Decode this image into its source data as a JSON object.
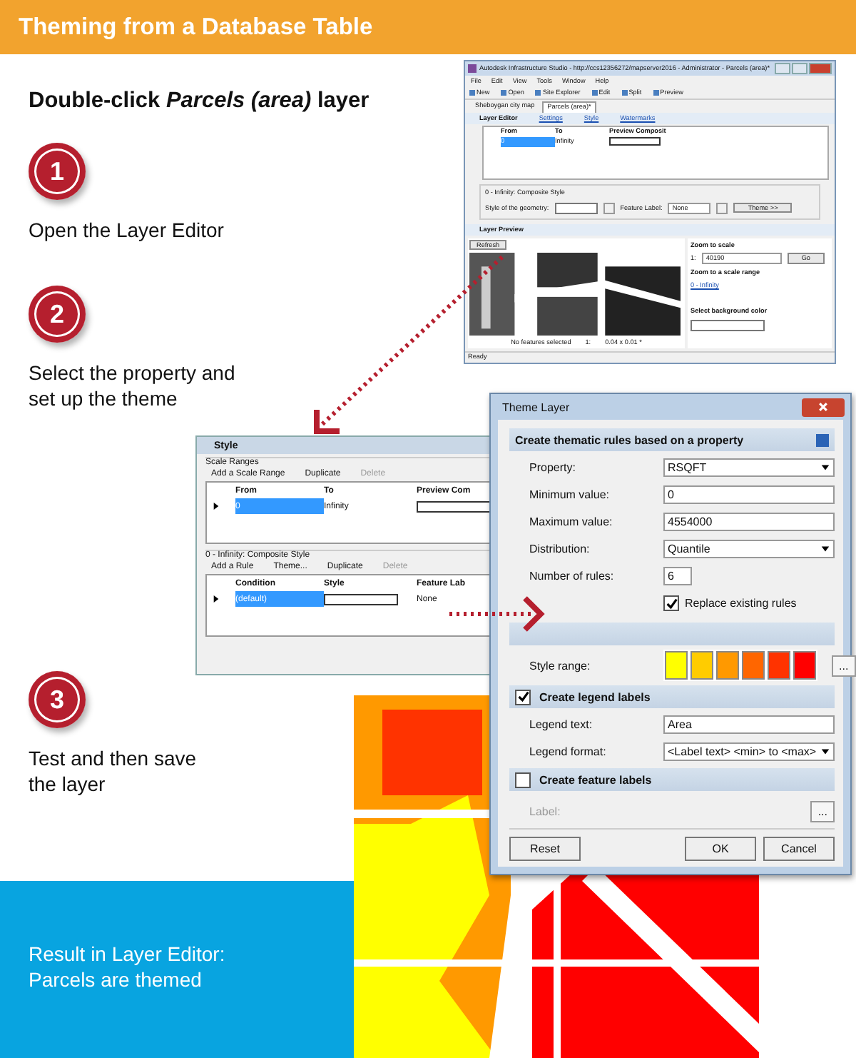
{
  "header": {
    "title": "Theming from a Database Table"
  },
  "intro": "Double-click *Parcels (area)* layer",
  "steps": [
    {
      "number": "1",
      "text": "Open the Layer Editor"
    },
    {
      "number": "2",
      "text": "Select the property and set up the theme"
    },
    {
      "number": "3",
      "text": "Test and then save the layer"
    }
  ],
  "result_panel": {
    "text": "Result in Layer Editor: Parcels are themed"
  },
  "app_window": {
    "title": "Autodesk Infrastructure Studio - http://ccs12356272/mapserver2016 - Administrator - Parcels (area)*",
    "menus": [
      "File",
      "Edit",
      "View",
      "Tools",
      "Window",
      "Help"
    ],
    "toolbar": [
      "New",
      "Open",
      "Site Explorer",
      "Edit",
      "Split",
      "Preview"
    ],
    "tabs": [
      {
        "label": "Sheboygan city map",
        "selected": false
      },
      {
        "label": "Parcels (area)*",
        "selected": true
      }
    ],
    "layer_editor": {
      "title": "Layer Editor",
      "links": [
        "Settings",
        "Style",
        "Watermarks"
      ],
      "columns": [
        "From",
        "To",
        "Preview Composit"
      ],
      "row": [
        "0",
        "Infinity"
      ],
      "group_title": "0 - Infinity: Composite Style",
      "style_label": "Style of the geometry:",
      "feature_label": "Feature Label:",
      "feature_value": "None",
      "theme_button": "Theme >>"
    },
    "layer_preview": {
      "title": "Layer Preview",
      "refresh": "Refresh",
      "status": [
        "No features selected",
        "1:",
        "0.04 x 0.01 *"
      ],
      "zoom_scale_label": "Zoom to scale",
      "scale_prefix": "1:",
      "scale_value": "40190",
      "go": "Go",
      "zoom_range_label": "Zoom to a scale range",
      "range_link": "0 - Infinity",
      "background_label": "Select background color"
    },
    "status": "Ready"
  },
  "style_panel": {
    "title": "Style",
    "scale_ranges": {
      "legend": "Scale Ranges",
      "actions": [
        {
          "label": "Add a Scale Range",
          "disabled": false
        },
        {
          "label": "Duplicate",
          "disabled": false
        },
        {
          "label": "Delete",
          "disabled": true
        }
      ],
      "columns": [
        "From",
        "To",
        "Preview Com"
      ],
      "row": [
        "0",
        "Infinity"
      ]
    },
    "composite": {
      "legend": "0 - Infinity: Composite Style",
      "actions": [
        {
          "label": "Add a Rule",
          "disabled": false
        },
        {
          "label": "Theme...",
          "disabled": false
        },
        {
          "label": "Duplicate",
          "disabled": false
        },
        {
          "label": "Delete",
          "disabled": true
        }
      ],
      "columns": [
        "Condition",
        "Style",
        "Feature Lab"
      ],
      "condition": "(default)",
      "label": "None"
    }
  },
  "theme_dialog": {
    "title": "Theme Layer",
    "section": "Create thematic rules based on a property",
    "fields": [
      {
        "kind": "select",
        "label": "Property:",
        "value": "RSQFT"
      },
      {
        "kind": "text",
        "label": "Minimum value:",
        "value": "0"
      },
      {
        "kind": "text",
        "label": "Maximum value:",
        "value": "4554000"
      },
      {
        "kind": "select",
        "label": "Distribution:",
        "value": "Quantile"
      },
      {
        "kind": "short",
        "label": "Number of rules:",
        "value": "6"
      }
    ],
    "replace_rules": {
      "label": "Replace existing rules",
      "checked": true
    },
    "style_range": {
      "label": "Style range:",
      "swatches": [
        {
          "color": "#ffff00"
        },
        {
          "color": "#ffcc00"
        },
        {
          "color": "#ff9900"
        },
        {
          "color": "#ff6600"
        },
        {
          "color": "#ff3300"
        },
        {
          "color": "#ff0000"
        }
      ]
    },
    "legend_labels": {
      "title": "Create legend labels",
      "checked": true,
      "text_label": "Legend text:",
      "text_value": "Area",
      "format_label": "Legend format:",
      "format_value": "<Label text> <min> to <max>"
    },
    "feature_labels": {
      "title": "Create feature labels",
      "checked": false,
      "label": "Label:"
    },
    "browse_label": "...",
    "buttons": [
      "Reset",
      "OK",
      "Cancel"
    ]
  }
}
